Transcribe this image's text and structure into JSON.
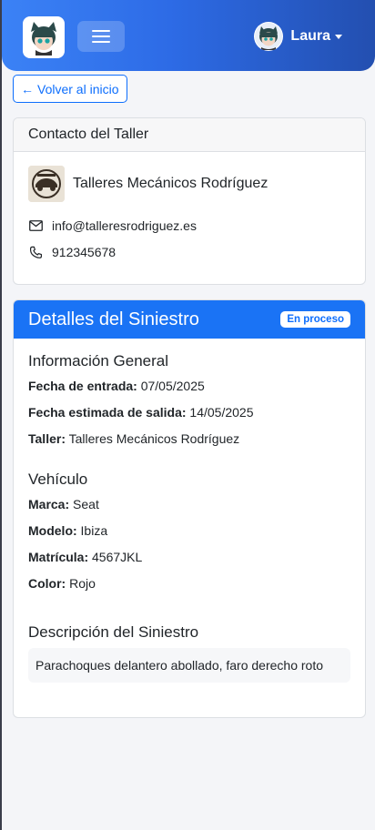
{
  "header": {
    "user_name": "Laura"
  },
  "back_button": {
    "label": "Volver al inicio"
  },
  "contact": {
    "title": "Contacto del Taller",
    "workshop_name": "Talleres Mecánicos Rodríguez",
    "email": "info@talleresrodriguez.es",
    "phone": "912345678"
  },
  "details": {
    "title": "Detalles del Siniestro",
    "status": "En proceso",
    "general": {
      "title": "Información General",
      "entry_label": "Fecha de entrada:",
      "entry_value": "07/05/2025",
      "exit_label": "Fecha estimada de salida:",
      "exit_value": "14/05/2025",
      "workshop_label": "Taller:",
      "workshop_value": "Talleres Mecánicos Rodríguez"
    },
    "vehicle": {
      "title": "Vehículo",
      "brand_label": "Marca:",
      "brand_value": "Seat",
      "model_label": "Modelo:",
      "model_value": "Ibiza",
      "plate_label": "Matrícula:",
      "plate_value": "4567JKL",
      "color_label": "Color:",
      "color_value": "Rojo"
    },
    "description": {
      "title": "Descripción del Siniestro",
      "text": "Parachoques delantero abollado, faro derecho roto"
    }
  },
  "icons": {
    "logo": "app-logo-icon",
    "menu": "hamburger-menu-icon",
    "avatar": "user-avatar",
    "email": "envelope-icon",
    "phone": "phone-icon",
    "back": "arrow-left-icon"
  },
  "colors": {
    "primary": "#0d6efd",
    "header_blue": "#1a73f5"
  }
}
